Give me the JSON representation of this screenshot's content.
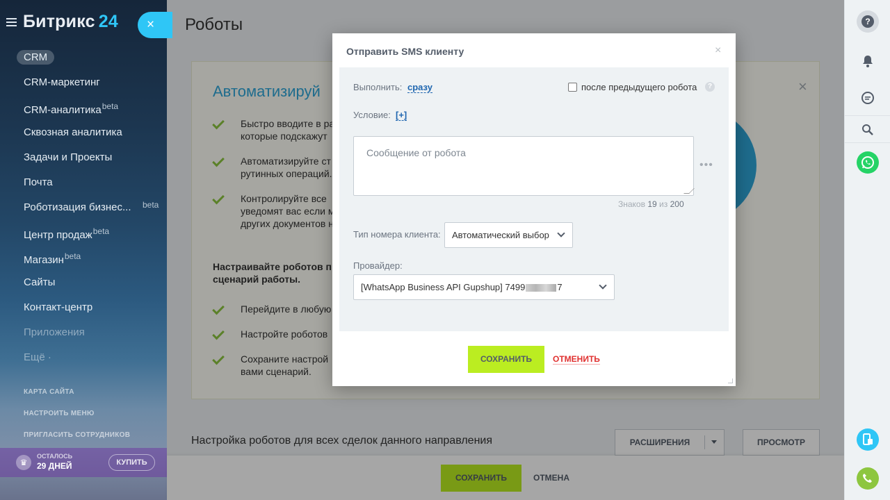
{
  "sidebar": {
    "logo_text": "Битрикс",
    "logo_num": "24",
    "close_icon": "×",
    "items": [
      {
        "label": "CRM"
      },
      {
        "label": "CRM-маркетинг"
      },
      {
        "label": "CRM-аналитика",
        "badge": "beta"
      },
      {
        "label": "Сквозная аналитика"
      },
      {
        "label": "Задачи и Проекты"
      },
      {
        "label": "Почта"
      },
      {
        "label": "Роботизация бизнес...",
        "badge": "beta"
      },
      {
        "label": "Центр продаж",
        "badge": "beta"
      },
      {
        "label": "Магазин",
        "badge": "beta"
      },
      {
        "label": "Сайты"
      },
      {
        "label": "Контакт-центр"
      },
      {
        "label": "Приложения"
      },
      {
        "label": "Ещё ·"
      }
    ],
    "small_links": [
      "КАРТА САЙТА",
      "НАСТРОИТЬ МЕНЮ",
      "ПРИГЛАСИТЬ СОТРУДНИКОВ"
    ],
    "trial": {
      "top": "ОСТАЛОСЬ",
      "bottom": "29 ДНЕЙ",
      "buy": "КУПИТЬ",
      "crown": "♛"
    }
  },
  "main": {
    "title": "Роботы",
    "promo": {
      "heading": "Автоматизируй",
      "close": "×",
      "bullets": [
        "Быстро вводите в ра\nкоторые подскажут",
        "Автоматизируйте ст\nрутинных операций.",
        "Контролируйте все\nуведомят вас если м\nдругих документов н"
      ],
      "bold_text": "Настраивайте роботов п\nсценарий работы.",
      "steps": [
        "Перейдите в любую",
        "Настройте роботов",
        "Сохраните настрой\nвами сценарий."
      ]
    },
    "robots_row_label": "Настройка роботов для всех сделок данного направления",
    "extensions_button": "РАСШИРЕНИЯ",
    "preview_button": "ПРОСМОТР"
  },
  "bottom_bar": {
    "save": "СОХРАНИТЬ",
    "cancel": "ОТМЕНА"
  },
  "right_bar": {
    "help": "?",
    "whatsapp_color": "#25d366",
    "phone_color": "#8dc63f",
    "accent": "#2fc6f6"
  },
  "modal": {
    "title": "Отправить SMS клиенту",
    "close": "×",
    "execute_label": "Выполнить:",
    "execute_value": "сразу",
    "after_prev_label": "после предыдущего робота",
    "help": "?",
    "condition_label": "Условие:",
    "condition_value": "[+]",
    "message_placeholder": "Сообщение от робота",
    "dots": "•••",
    "counter_label": "Знаков",
    "counter_value": "19",
    "counter_of": "из",
    "counter_max": "200",
    "number_type_label": "Тип номера клиента:",
    "number_type_value": "Автоматический выбор",
    "provider_label": "Провайдер:",
    "provider_prefix": "[WhatsApp Business API Gupshup] 7499",
    "provider_suffix": "7",
    "save": "СОХРАНИТЬ",
    "cancel": "ОТМЕНИТЬ"
  },
  "colors": {
    "save_green": "#bbed21",
    "cancel_red": "#e0302f",
    "link_blue": "#2067b0",
    "promo_blue": "#2fa6d9"
  }
}
